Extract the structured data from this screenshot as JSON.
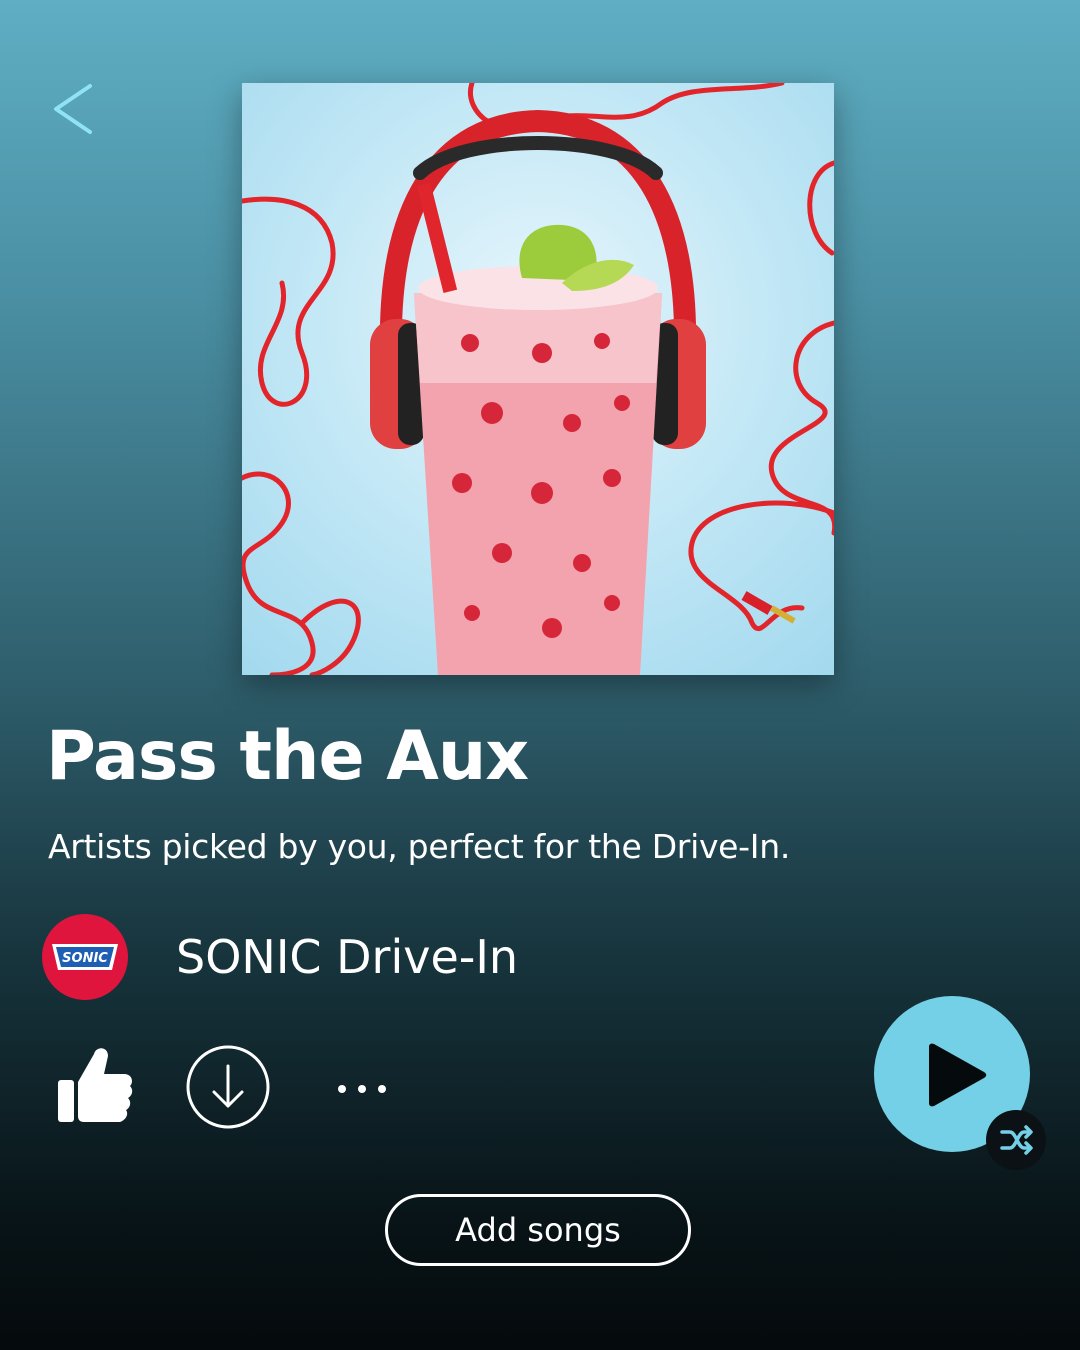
{
  "header": {
    "back_icon": "chevron-left-icon"
  },
  "playlist": {
    "cover_image": "drink-with-headphones-artwork",
    "title": "Pass the Aux",
    "description": "Artists picked by you, perfect for the Drive-In.",
    "owner": {
      "name": "SONIC Drive-In",
      "avatar_text": "SONIC",
      "avatar_color": "#e0153e"
    }
  },
  "actions": {
    "like_icon": "thumbs-up-icon",
    "download_icon": "download-icon",
    "more_icon": "more-horizontal-icon",
    "play_icon": "play-icon",
    "shuffle_icon": "shuffle-icon",
    "add_songs_label": "Add songs"
  },
  "colors": {
    "accent": "#74d0e6",
    "back_icon": "#8fe3f2"
  }
}
